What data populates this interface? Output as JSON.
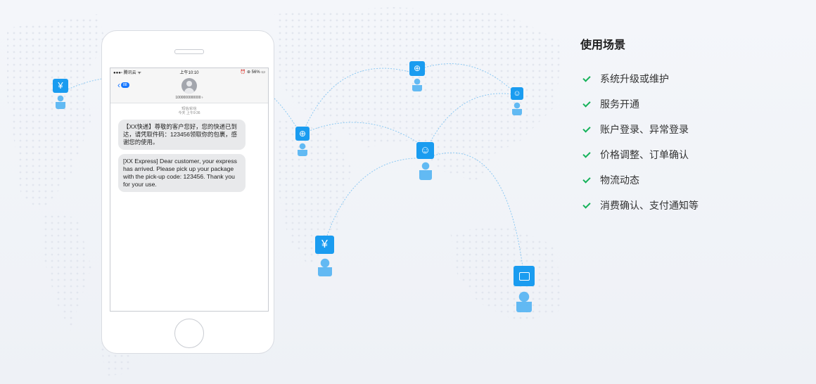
{
  "phone": {
    "status": {
      "carrier": "●●●▫ 腾讯云 ᯤ",
      "time": "上午10:10",
      "battery": "⏰ ⊛ 56% ▭"
    },
    "back_badge": "88",
    "sender_number": "1000000000000 ›",
    "msg_meta_1": "短信/彩信",
    "msg_meta_2": "今天 上午9:36",
    "messages": [
      "【XX快递】尊敬的客户您好，您的快递已到达，请凭取件码：123456领取你的包裹，感谢您的使用。",
      "[XX Express] Dear customer, your express has arrived. Please pick up your package with the pick-up code: 123456. Thank you for your use."
    ]
  },
  "map_nodes": [
    {
      "name": "yen-icon",
      "glyph": "¥"
    },
    {
      "name": "upload-icon",
      "glyph": "↑"
    },
    {
      "name": "upload-icon",
      "glyph": "↑"
    },
    {
      "name": "user-icon",
      "glyph": "👤"
    },
    {
      "name": "user-icon",
      "glyph": "👤"
    },
    {
      "name": "yen-icon",
      "glyph": "¥"
    },
    {
      "name": "wallet-icon",
      "glyph": "▭"
    }
  ],
  "colors": {
    "accent": "#1a9cf0",
    "check": "#16b25a"
  },
  "scenes": {
    "title": "使用场景",
    "items": [
      "系统升级或维护",
      "服务开通",
      "账户登录、异常登录",
      "价格调整、订单确认",
      "物流动态",
      "消费确认、支付通知等"
    ]
  }
}
